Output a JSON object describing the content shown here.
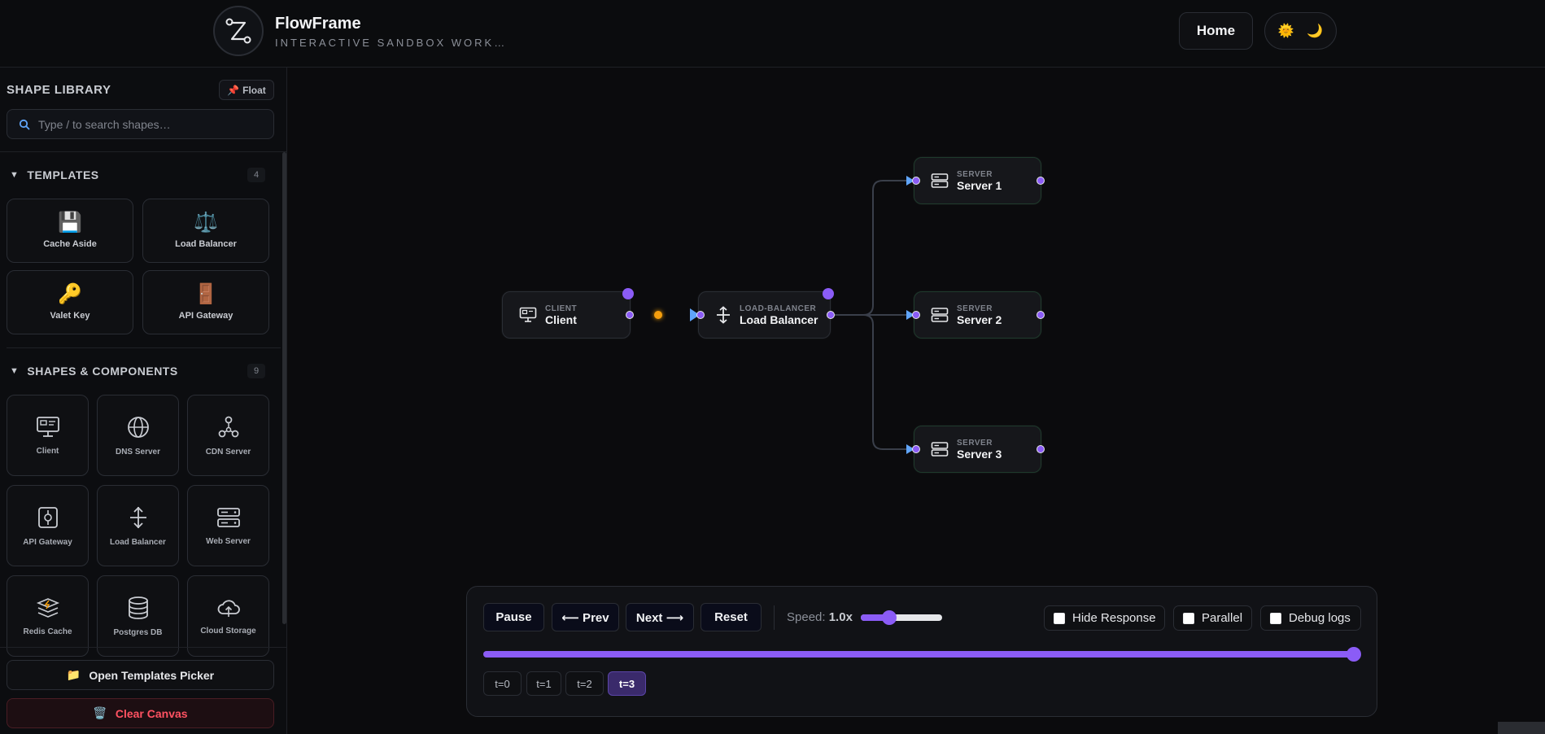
{
  "header": {
    "title": "FlowFrame",
    "subtitle": "INTERACTIVE SANDBOX WORK…",
    "home_label": "Home",
    "theme_light_icon": "🌞",
    "theme_dark_icon": "🌙"
  },
  "sidebar": {
    "title": "SHAPE LIBRARY",
    "float_label": "Float",
    "search_placeholder": "Type / to search shapes…",
    "templates": {
      "heading": "TEMPLATES",
      "count": "4",
      "items": [
        {
          "label": "Cache Aside",
          "icon": "💾"
        },
        {
          "label": "Load Balancer",
          "icon": "⚖️"
        },
        {
          "label": "Valet Key",
          "icon": "🔑"
        },
        {
          "label": "API Gateway",
          "icon": "🚪"
        }
      ]
    },
    "shapes": {
      "heading": "SHAPES & COMPONENTS",
      "count": "9",
      "items": [
        {
          "label": "Client",
          "icon": "client-icon"
        },
        {
          "label": "DNS Server",
          "icon": "globe-icon"
        },
        {
          "label": "CDN Server",
          "icon": "network-icon"
        },
        {
          "label": "API Gateway",
          "icon": "gateway-icon"
        },
        {
          "label": "Load Balancer",
          "icon": "balancer-icon"
        },
        {
          "label": "Web Server",
          "icon": "server-icon"
        },
        {
          "label": "Redis Cache",
          "icon": "redis-icon"
        },
        {
          "label": "Postgres DB",
          "icon": "database-icon"
        },
        {
          "label": "Cloud Storage",
          "icon": "cloud-icon"
        }
      ]
    },
    "open_templates_label": "Open Templates Picker",
    "clear_canvas_label": "Clear Canvas"
  },
  "canvas": {
    "nodes": {
      "client": {
        "type": "CLIENT",
        "name": "Client"
      },
      "lb": {
        "type": "LOAD-BALANCER",
        "name": "Load Balancer"
      },
      "s1": {
        "type": "SERVER",
        "name": "Server 1"
      },
      "s2": {
        "type": "SERVER",
        "name": "Server 2"
      },
      "s3": {
        "type": "SERVER",
        "name": "Server 3"
      }
    }
  },
  "controls": {
    "pause": "Pause",
    "prev": "⟵ Prev",
    "next": "Next ⟶",
    "reset": "Reset",
    "speed_label": "Speed:",
    "speed_value": "1.0x",
    "speed_level": 0.35,
    "hide_response": "Hide Response",
    "parallel": "Parallel",
    "debug_logs": "Debug logs",
    "timeline_progress": 1.0,
    "steps": [
      "t=0",
      "t=1",
      "t=2",
      "t=3"
    ],
    "active_step": "t=3"
  },
  "colors": {
    "accent": "#8b5cf6",
    "flow": "#f59e0b",
    "danger": "#ff5262"
  }
}
